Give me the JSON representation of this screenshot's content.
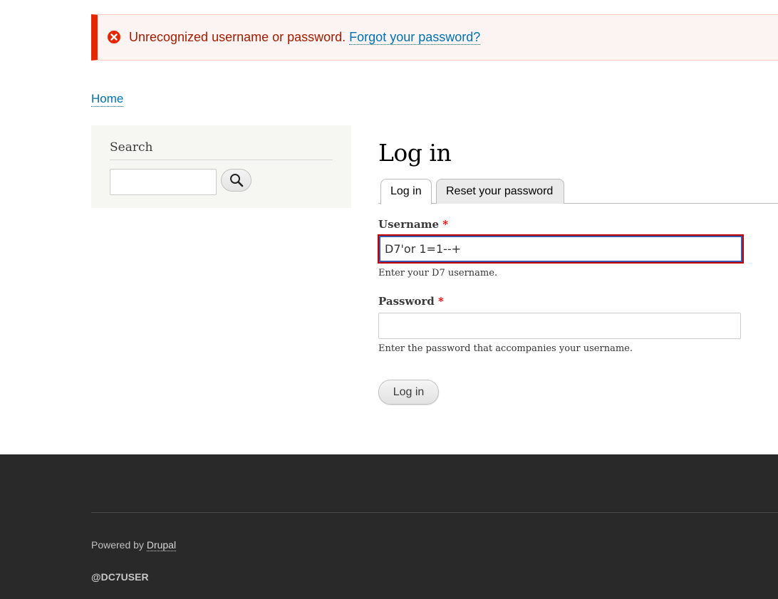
{
  "messages": {
    "error_text": "Unrecognized username or password.",
    "error_link": "Forgot your password?",
    "error_icon": "error-circle-x-icon",
    "error_color": "#e62600"
  },
  "breadcrumb": {
    "home": "Home"
  },
  "sidebar": {
    "title": "Search",
    "search_value": "",
    "search_button_icon": "search-icon"
  },
  "main": {
    "title": "Log in",
    "tabs": [
      {
        "label": "Log in",
        "active": true
      },
      {
        "label": "Reset your password",
        "active": false
      }
    ],
    "username": {
      "label": "Username",
      "required_mark": "*",
      "value": "D7'or 1=1--+",
      "description": "Enter your D7 username."
    },
    "password": {
      "label": "Password",
      "required_mark": "*",
      "value": "",
      "description": "Enter the password that accompanies your username."
    },
    "submit_label": "Log in"
  },
  "footer": {
    "powered_prefix": "Powered by ",
    "powered_link": "Drupal",
    "handle": "@DC7USER"
  }
}
